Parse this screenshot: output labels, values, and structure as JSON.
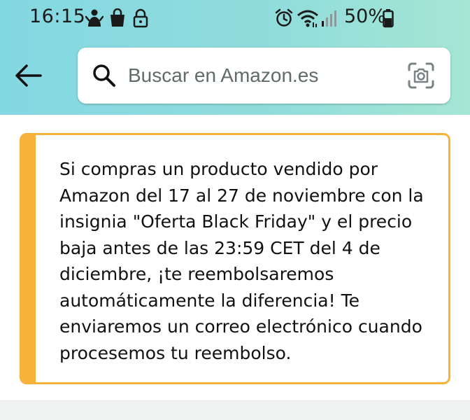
{
  "status_bar": {
    "time": "16:15",
    "battery_percent": "50%",
    "left_icons": [
      "person-icon",
      "shopping-bag-icon",
      "lock-icon"
    ],
    "right_icons": [
      "alarm-icon",
      "wifi-icon",
      "signal-icon",
      "battery-icon"
    ]
  },
  "header": {
    "back_icon": "back-arrow-icon",
    "search": {
      "placeholder": "Buscar en Amazon.es",
      "value": "",
      "camera_icon": "camera-scan-icon"
    },
    "gradient_colors": [
      "#84d8e2",
      "#a5e6d4"
    ]
  },
  "notice": {
    "accent_color": "#f7b23b",
    "lines": [
      "Si compras un producto vendido por",
      "Amazon del 17 al 27 de noviembre con la",
      "insignia \"Oferta Black Friday\" y el precio",
      "baja antes de las 23:59 CET del 4 de",
      "diciembre, ¡te reembolsaremos",
      "automáticamente la diferencia! Te",
      "enviaremos un correo electrónico cuando",
      "procesemos tu reembolso."
    ]
  }
}
